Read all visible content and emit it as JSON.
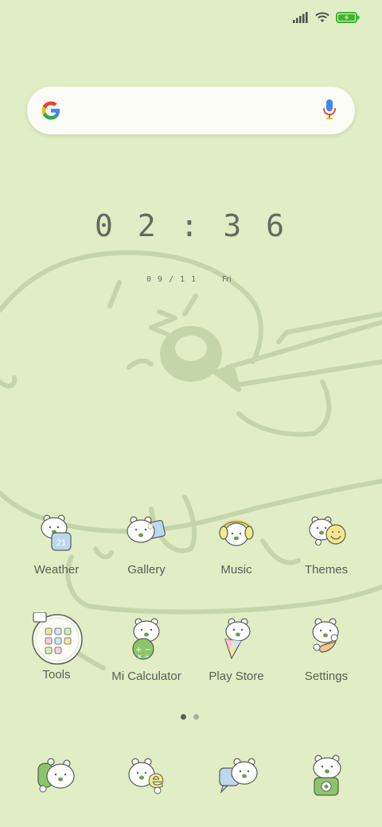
{
  "status_bar": {
    "signal_icon": "signal-bars-icon",
    "wifi_icon": "wifi-icon",
    "battery_icon": "battery-charging-icon",
    "battery_color": "#3fb532"
  },
  "search": {
    "logo_icon": "google-g-icon",
    "mic_icon": "microphone-icon",
    "placeholder": ""
  },
  "clock": {
    "time": "0 2 : 3 6",
    "date": "0 9 / 1 1",
    "day": "Fri"
  },
  "apps_row1": [
    {
      "label": "Weather",
      "icon": "weather-bear-icon"
    },
    {
      "label": "Gallery",
      "icon": "gallery-bear-icon"
    },
    {
      "label": "Music",
      "icon": "music-bear-icon"
    },
    {
      "label": "Themes",
      "icon": "themes-bear-icon"
    }
  ],
  "apps_row2": [
    {
      "label": "Tools",
      "icon": "tools-folder-icon"
    },
    {
      "label": "Mi Calculator",
      "icon": "calculator-bear-icon"
    },
    {
      "label": "Play Store",
      "icon": "play-store-bear-icon"
    },
    {
      "label": "Settings",
      "icon": "settings-bear-icon"
    }
  ],
  "weather_badge": "21",
  "page_indicator": {
    "pages": 2,
    "current": 1
  },
  "dock": [
    {
      "icon": "phone-bear-icon"
    },
    {
      "icon": "browser-bear-icon"
    },
    {
      "icon": "messages-bear-icon"
    },
    {
      "icon": "camera-bear-icon"
    }
  ],
  "colors": {
    "background": "#e0edc5",
    "line_art": "#c4d4a9",
    "text": "#5e6156",
    "accent_green": "#6b9e4f"
  }
}
